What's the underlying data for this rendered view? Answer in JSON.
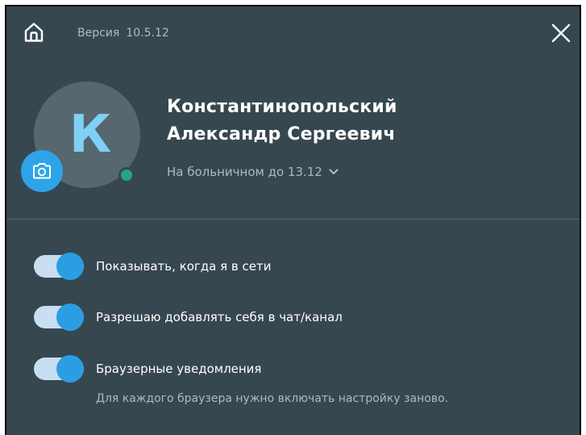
{
  "header": {
    "version_label": "Версия",
    "version_number": "10.5.12",
    "home_icon": "home-icon",
    "close_icon": "close-icon"
  },
  "profile": {
    "avatar_letter": "К",
    "name_line1": "Константинопольский",
    "name_line2": "Александр Сергеевич",
    "status": "На больничном до 13.12",
    "presence_color": "#26a67c"
  },
  "settings": [
    {
      "label": "Показывать, когда я в сети",
      "enabled": true
    },
    {
      "label": "Разрешаю добавлять себя в чат/канал",
      "enabled": true
    },
    {
      "label": "Браузерные уведомления",
      "enabled": true
    }
  ],
  "notifications_hint": "Для каждого браузера нужно включать настройку заново.",
  "colors": {
    "background": "#37474f",
    "accent": "#2b9ee3",
    "avatar_letter": "#81cff5"
  }
}
